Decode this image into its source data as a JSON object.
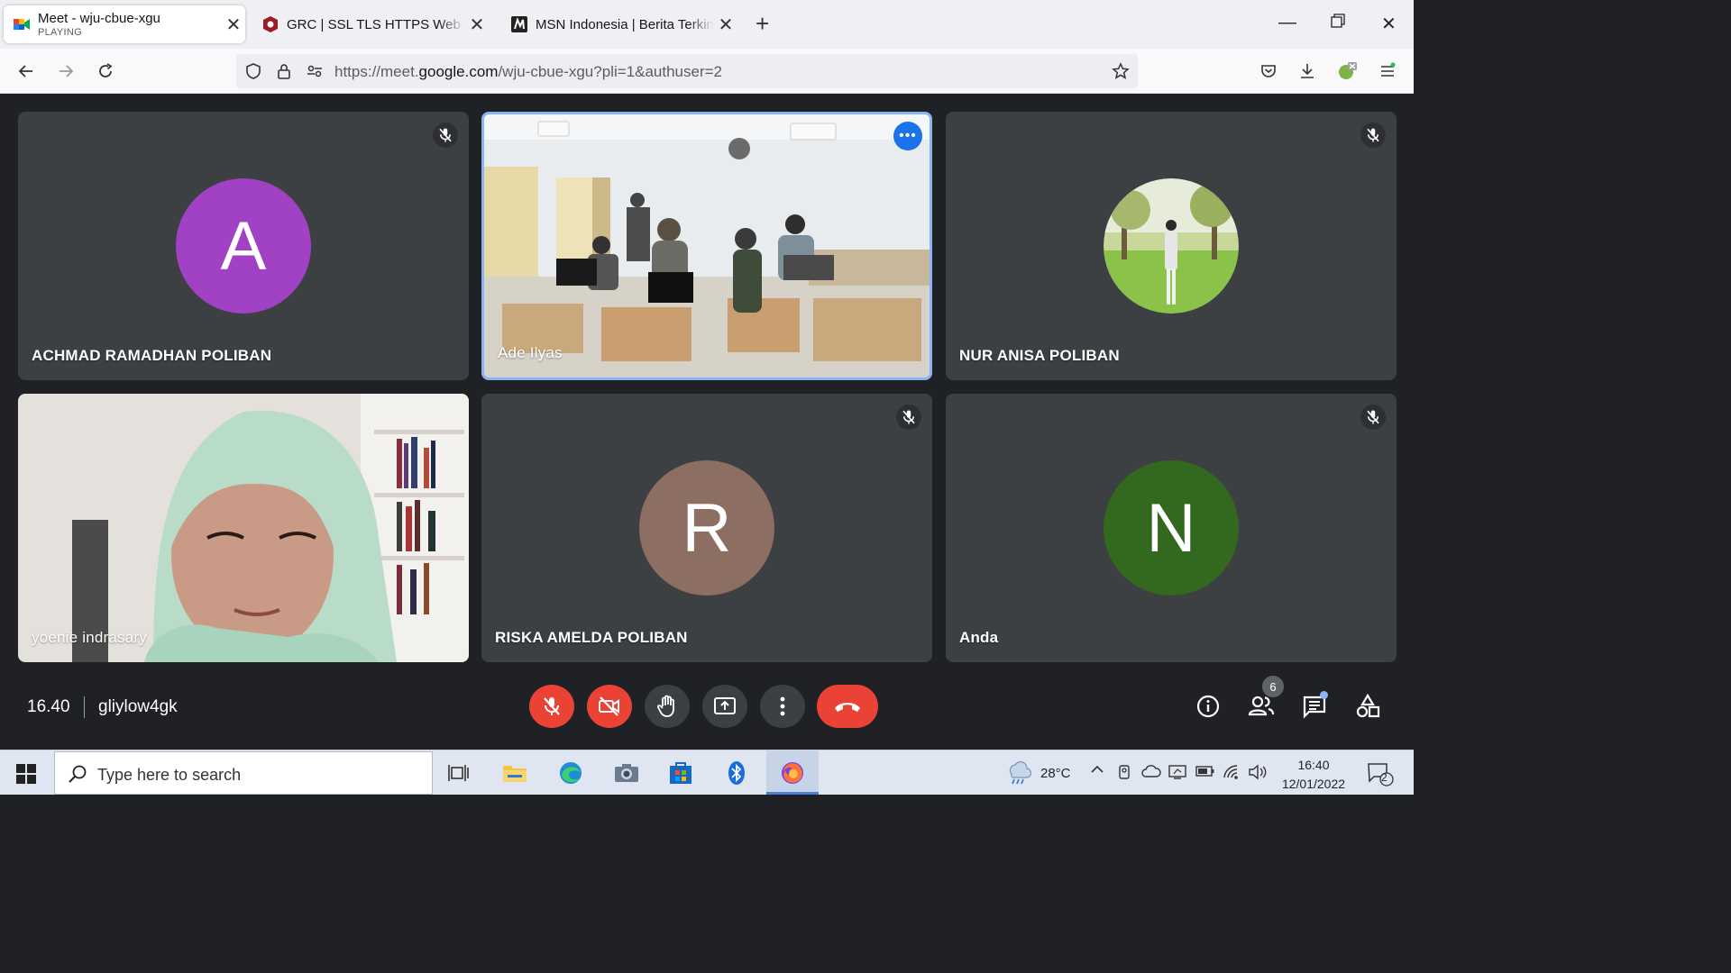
{
  "browser": {
    "tabs": [
      {
        "title": "Meet - wju-cbue-xgu",
        "subtitle": "PLAYING",
        "active": true
      },
      {
        "title": "GRC | SSL TLS HTTPS Web Server",
        "active": false
      },
      {
        "title": "MSN Indonesia | Berita Terkini H",
        "active": false
      }
    ],
    "url_prefix": "https://meet.",
    "url_domain": "google.com",
    "url_path": "/wju-cbue-xgu?pli=1&authuser=2"
  },
  "meet": {
    "participants": [
      {
        "name": "ACHMAD RAMADHAN POLIBAN",
        "initial": "A",
        "avatar_color": "#a142c4",
        "muted": true,
        "video": false
      },
      {
        "name": "Ade Ilyas",
        "muted": false,
        "video": true,
        "active_speaker": true
      },
      {
        "name": "NUR ANISA POLIBAN",
        "muted": true,
        "video": false,
        "photo_avatar": true
      },
      {
        "name": "yoenie indrasary",
        "muted": false,
        "video": true
      },
      {
        "name": "RISKA AMELDA POLIBAN",
        "initial": "R",
        "avatar_color": "#8d6e63",
        "muted": true,
        "video": false
      },
      {
        "name": "Anda",
        "initial": "N",
        "avatar_color": "#33691e",
        "muted": true,
        "video": false
      }
    ],
    "time": "16.40",
    "meeting_code": "gliylow4gk",
    "people_count": "6",
    "controls": [
      "microphone-off",
      "camera-off",
      "raise-hand",
      "present-screen",
      "more-options",
      "leave-call"
    ],
    "right_controls": [
      "meeting-info",
      "people",
      "chat",
      "activities"
    ],
    "colors": {
      "background": "#202124",
      "tile": "#3c4043",
      "danger": "#ea4335",
      "accent": "#8ab4f8"
    }
  },
  "taskbar": {
    "search_placeholder": "Type here to search",
    "weather": "28°C",
    "time": "16:40",
    "date": "12/01/2022",
    "notifications": "2"
  }
}
